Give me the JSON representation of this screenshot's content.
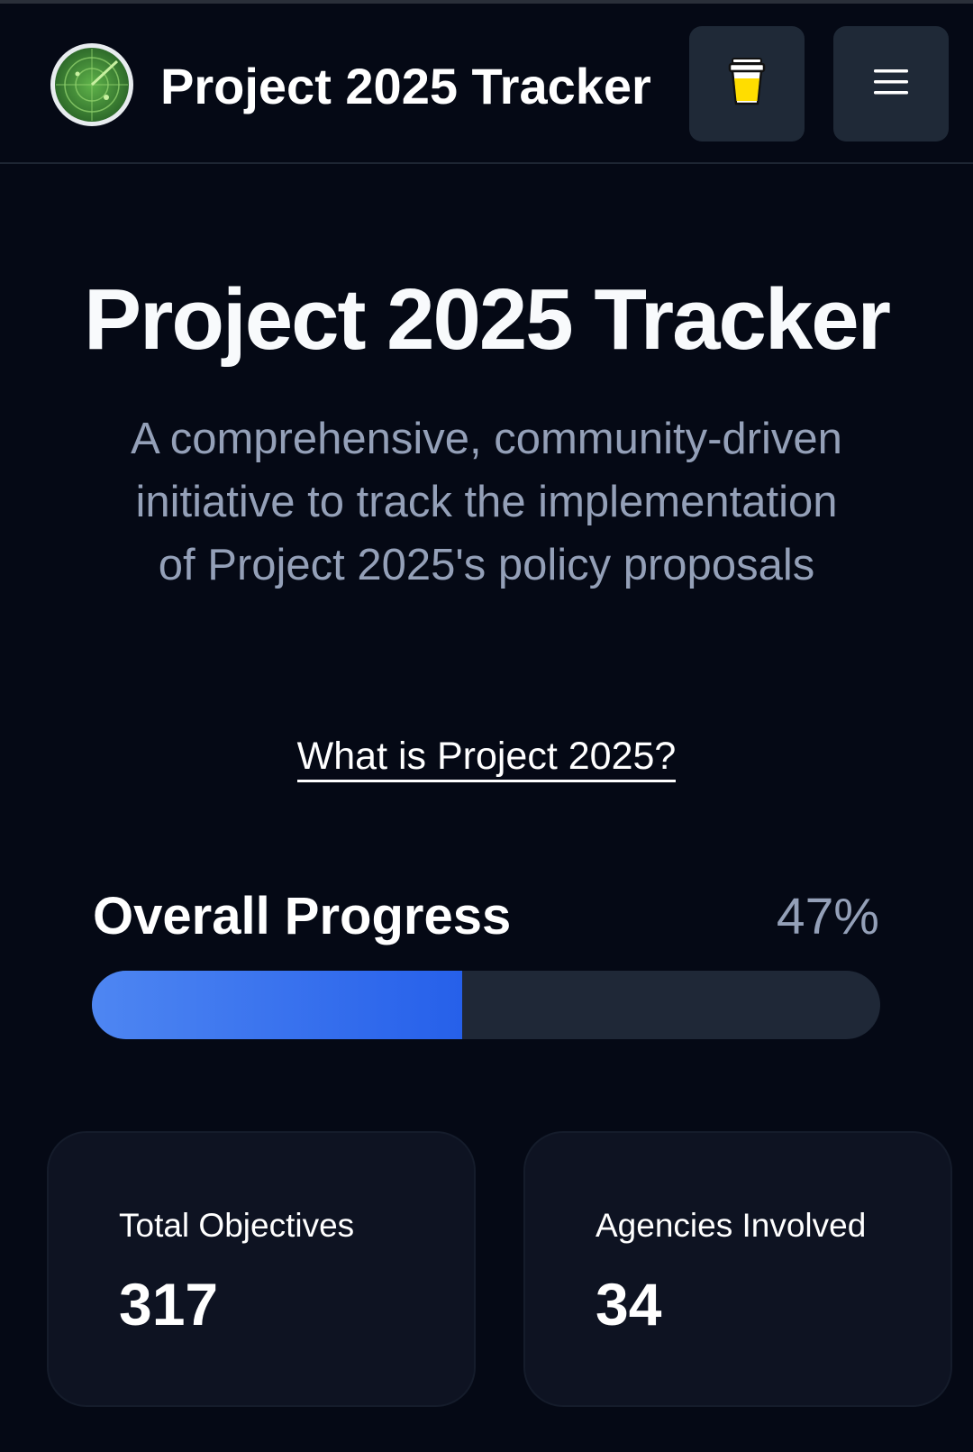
{
  "header": {
    "title": "Project 2025 Tracker",
    "logo_icon": "radar-icon",
    "coffee_button_icon": "coffee-cup-icon",
    "menu_button_icon": "hamburger-menu-icon"
  },
  "hero": {
    "title": "Project 2025 Tracker",
    "subtitle": "A comprehensive, community-driven initiative to track the implementation of Project 2025's policy proposals",
    "link_text": "What is Project 2025?"
  },
  "progress": {
    "label": "Overall Progress",
    "percent_text": "47%",
    "value": 0.47,
    "colors": {
      "fill_start": "#4e86f2",
      "fill_end": "#2660ea",
      "track": "#1f2837"
    }
  },
  "stats": [
    {
      "label": "Total Objectives",
      "value": "317"
    },
    {
      "label": "Agencies Involved",
      "value": "34"
    }
  ],
  "colors": {
    "background": "#050915",
    "card": "#0e1322",
    "button": "#1f2937",
    "muted_text": "#94a0b8"
  }
}
